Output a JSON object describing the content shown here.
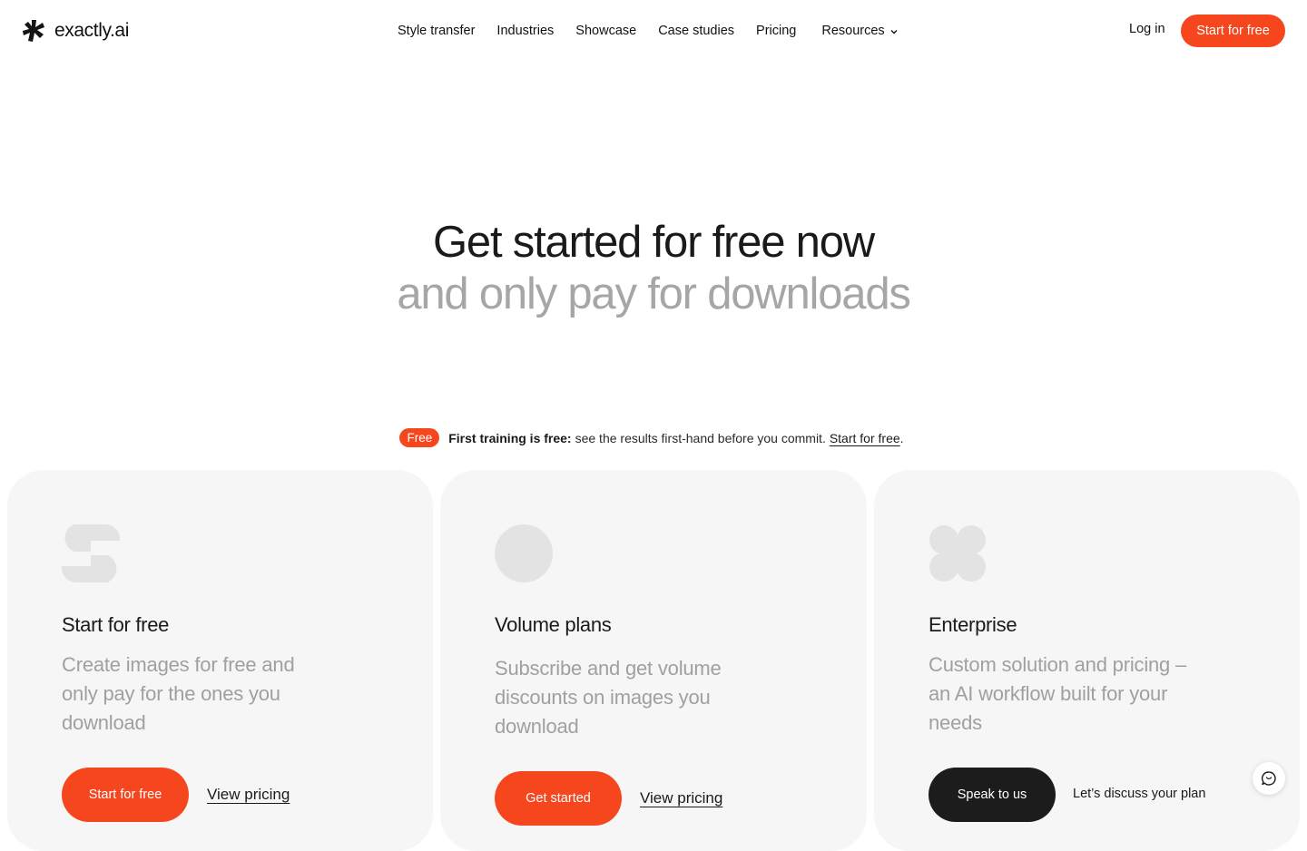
{
  "header": {
    "logo_text": "exactly.ai",
    "nav": [
      {
        "label": "Style transfer"
      },
      {
        "label": "Industries"
      },
      {
        "label": "Showcase"
      },
      {
        "label": "Case studies"
      },
      {
        "label": "Pricing"
      },
      {
        "label": "Resources"
      }
    ],
    "login_label": "Log in",
    "cta_label": "Start for free"
  },
  "hero": {
    "line1": "Get started for free now",
    "line2": "and only pay for downloads"
  },
  "notice": {
    "badge": "Free",
    "bold": "First training is free:",
    "text": "see the results first-hand before you commit.",
    "link": "Start for free",
    "end": "."
  },
  "cards": [
    {
      "icon": "s-shape-icon",
      "title": "Start for free",
      "description": "Create images for free and only pay for the ones you download",
      "button": "Start for free",
      "link": "View pricing"
    },
    {
      "icon": "circle-icon",
      "title": "Volume plans",
      "description": "Subscribe and get volume discounts on images you download",
      "button": "Get started",
      "link": "View pricing"
    },
    {
      "icon": "clover-icon",
      "title": "Enterprise",
      "description": "Custom solution and pricing – an AI workflow built for your needs",
      "button": "Speak to us",
      "note": "Let’s discuss your plan"
    }
  ],
  "chat": {
    "icon": "chat-icon"
  },
  "colors": {
    "accent": "#f5461e",
    "dark": "#1c1c1c",
    "card_bg": "#f6f6f6",
    "muted_text": "#a6a6a6"
  }
}
